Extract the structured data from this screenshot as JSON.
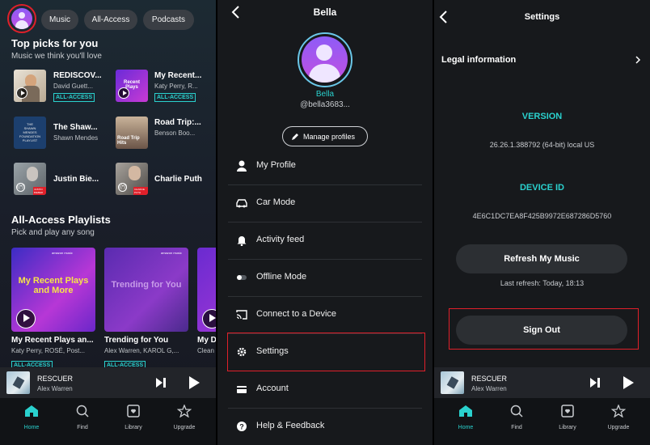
{
  "home": {
    "chips": [
      "Music",
      "All-Access",
      "Podcasts"
    ],
    "top_picks": {
      "title": "Top picks for you",
      "subtitle": "Music we think you'll love",
      "items": [
        {
          "title": "REDISCOV...",
          "artist": "David Guett...",
          "badge": "ALL-ACCESS"
        },
        {
          "title": "My Recent...",
          "artist": "Katy Perry, R...",
          "badge": "ALL-ACCESS"
        },
        {
          "title": "The Shaw...",
          "artist": "Shawn Mendes",
          "badge": ""
        },
        {
          "title": "Road Trip:...",
          "artist": "Benson Boo...",
          "badge": ""
        },
        {
          "title": "Justin Bie...",
          "artist": "",
          "badge": ""
        },
        {
          "title": "Charlie Puth",
          "artist": "",
          "badge": ""
        }
      ],
      "thumb_texts": {
        "recent": "Recent Plays",
        "shaw_a": "THE",
        "shaw_b": "SHAWN",
        "shaw_c": "MENDES",
        "shaw_d": "FOUNDATION",
        "shaw_e": "PLAYLIST",
        "road_a": "Road Trip",
        "road_b": "Hits",
        "justin": "JUSTIN BIEBER",
        "charlie": "CHARLIE PUTH"
      }
    },
    "playlists": {
      "title": "All-Access Playlists",
      "subtitle": "Pick and play any song",
      "brand": "amazon music",
      "cards": [
        {
          "art": "My Recent Plays and More",
          "title": "My Recent Plays an...",
          "sub": "Katy Perry, ROSÉ, Post...",
          "badge": "ALL-ACCESS"
        },
        {
          "art": "Trending for You",
          "title": "Trending for You",
          "sub": "Alex Warren, KAROL G,...",
          "badge": "ALL-ACCESS"
        },
        {
          "art": "",
          "title": "My D",
          "sub": "Clean",
          "badge": ""
        }
      ]
    },
    "player": {
      "track": "RESCUER",
      "artist": "Alex Warren"
    },
    "nav": [
      "Home",
      "Find",
      "Library",
      "Upgrade"
    ]
  },
  "profile": {
    "title": "Bella",
    "name": "Bella",
    "handle": "@bella3683...",
    "manage_label": "Manage profiles",
    "menu": [
      {
        "label": "My Profile",
        "icon": "person-icon"
      },
      {
        "label": "Car Mode",
        "icon": "car-icon"
      },
      {
        "label": "Activity feed",
        "icon": "bell-icon"
      },
      {
        "label": "Offline Mode",
        "icon": "toggle-icon"
      },
      {
        "label": "Connect to a Device",
        "icon": "cast-icon"
      },
      {
        "label": "Settings",
        "icon": "gear-icon"
      },
      {
        "label": "Account",
        "icon": "card-icon"
      },
      {
        "label": "Help & Feedback",
        "icon": "help-icon"
      }
    ]
  },
  "settings": {
    "title": "Settings",
    "legal": "Legal information",
    "version_label": "VERSION",
    "version_value": "26.26.1.388792 (64-bit) local US",
    "device_label": "DEVICE ID",
    "device_value": "4E6C1DC7EA8F425B9972E687286D5760",
    "refresh_label": "Refresh My Music",
    "last_refresh": "Last refresh: Today, 18:13",
    "signout_label": "Sign Out",
    "player": {
      "track": "RESCUER",
      "artist": "Alex Warren"
    },
    "nav": [
      "Home",
      "Find",
      "Library",
      "Upgrade"
    ]
  },
  "colors": {
    "accent": "#2ad1ce",
    "highlight": "#e0202a",
    "avatar": "#a45cf0"
  }
}
